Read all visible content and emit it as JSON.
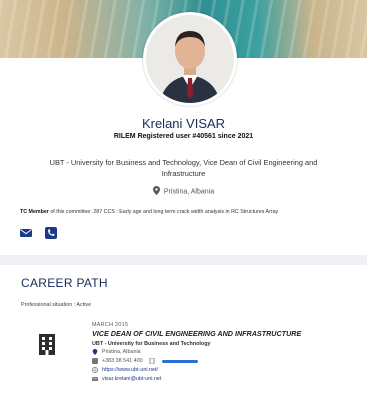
{
  "profile": {
    "name": "Krelani VISAR",
    "registration": "RILEM Registered user #40561 since 2021",
    "affiliation": "UBT - University for Business and Technology, Vice Dean of Civil Engineering and Infrastructure",
    "location": "Pristina, Albania",
    "tc_label": "TC Member",
    "tc_text": "of this committee: 287 CCS : Early age and long term crack width analysis in RC Structures Array"
  },
  "career": {
    "title": "CAREER PATH",
    "situation": "Professional situation : Active",
    "entry": {
      "date": "MARCH 2015",
      "role": "VICE DEAN OF CIVIL ENGINEERING AND INFRASTRUCTURE",
      "organization": "UBT - University for Business and Technology",
      "location": "Pristina, Albania",
      "phone": "+383 38 541 400",
      "website": "https://www.ubt-uni.net/",
      "email": "visar.krelani@ubt-uni.net"
    }
  },
  "icons": {
    "pin": "map-pin-icon",
    "email": "envelope-icon",
    "phone": "phone-icon",
    "building": "building-icon",
    "mobile": "mobile-phone-icon",
    "web": "globe-icon",
    "mail": "mail-icon"
  },
  "colors": {
    "navy": "#1b2a5a",
    "accent_blue": "#1b3a8a",
    "link_blue": "#2b6fd6"
  }
}
